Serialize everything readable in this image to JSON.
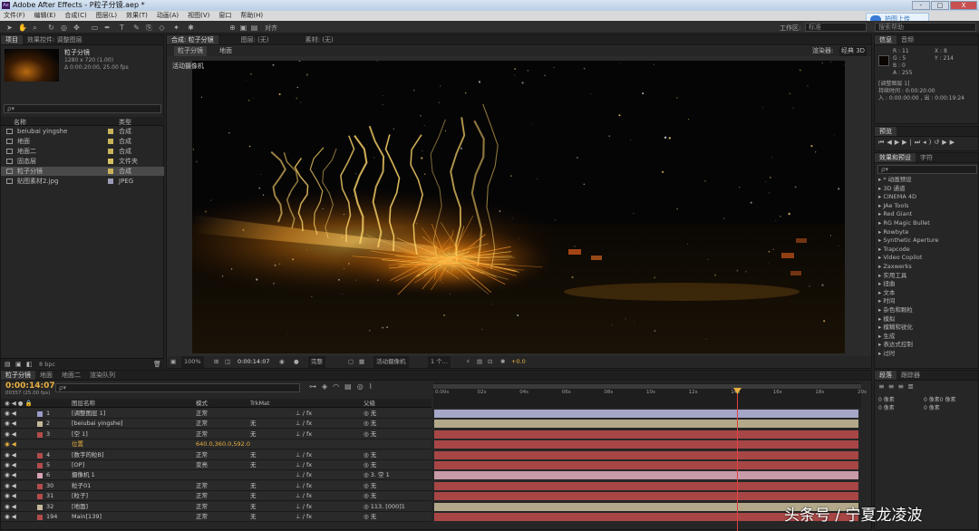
{
  "window": {
    "title": "Adobe After Effects - P粒子分镜.aep *",
    "app_icon": "Ae",
    "buttons": [
      "-",
      "□",
      "X"
    ]
  },
  "menu": [
    "文件(F)",
    "编辑(E)",
    "合成(C)",
    "图层(L)",
    "效果(T)",
    "动画(A)",
    "视图(V)",
    "窗口",
    "帮助(H)"
  ],
  "upload": {
    "label": "拍图上传"
  },
  "toolbar": {
    "snap_label": "对齐",
    "workspace_label": "工作区:",
    "workspace_value": "标准",
    "search_placeholder": "搜索帮助"
  },
  "project": {
    "tabs": [
      "项目",
      "效果控件: 调整图层"
    ],
    "item_name": "粒子分镜",
    "item_info1": "1280 x 720 (1.00)",
    "item_info2": "Δ 0:00:20:00, 25.00 fps",
    "search_placeholder": "ρ▾",
    "col_name": "名称",
    "col_type": "类型",
    "items": [
      {
        "name": "beiubai yingshe",
        "type": "合成",
        "color": "#c8b35a"
      },
      {
        "name": "地面",
        "type": "合成",
        "color": "#c8b35a"
      },
      {
        "name": "地面二",
        "type": "合成",
        "color": "#c8b35a"
      },
      {
        "name": "固态层",
        "type": "文件夹",
        "color": "#d7c060"
      },
      {
        "name": "粒子分镜",
        "type": "合成",
        "color": "#c8b35a"
      },
      {
        "name": "贴图素材2.jpg",
        "type": "JPEG",
        "color": "#9b9bb5"
      }
    ],
    "bpc": "8 bpc"
  },
  "composition": {
    "tabs": [
      "合成: 粒子分镜",
      "图层: (无)",
      "素材: (无)"
    ],
    "subtabs": [
      "粒子分镜",
      "地面"
    ],
    "renderer_label": "渲染器:",
    "renderer_value": "经典 3D",
    "camera_label": "活动摄像机",
    "footer": [
      "100%",
      "0:00:14:07",
      "完整",
      "活动摄像机",
      "1 个...",
      "+0.0"
    ]
  },
  "info": {
    "tabs": [
      "信息",
      "音频"
    ],
    "r": "R : 11",
    "g": "G : 5",
    "b": "B : 0",
    "a": "A : 255",
    "x": "X : 8",
    "y": "Y : 214",
    "layer": "[调整图层 1]",
    "duration": "持续时间 : 0:00:20:00",
    "in_out": "入 : 0:00:00:00 , 出 : 0:00:19:24"
  },
  "preview": {
    "tab": "预览"
  },
  "effects": {
    "tabs": [
      "效果和预设",
      "字符"
    ],
    "search_placeholder": "ρ▾",
    "items": [
      "* 动画预设",
      "3D 通道",
      "CINEMA 4D",
      "JAe Tools",
      "Red Giant",
      "RG Magic Bullet",
      "Rowbyte",
      "Synthetic Aperture",
      "Trapcode",
      "Video Copilot",
      "Zaxwerks",
      "实用工具",
      "扭曲",
      "文本",
      "时间",
      "杂色和颗粒",
      "模拟",
      "模糊和锐化",
      "生成",
      "表达式控制",
      "过时"
    ]
  },
  "paragraph": {
    "tabs": [
      "段落",
      "跟踪器"
    ],
    "px": [
      "0 像素",
      "0 像素",
      "0 像素",
      "0 像素",
      "0 像素"
    ]
  },
  "timeline": {
    "tabs": [
      "粒子分镜",
      "地面",
      "地面二",
      "渲染队列"
    ],
    "timecode": "0:00:14:07",
    "frames": "00357 (25.00 fps)",
    "search_placeholder": "ρ▾",
    "col_name": "图层名称",
    "col_mode": "模式",
    "col_trkmat": "TrkMat",
    "col_parent": "父级",
    "ruler": [
      "0:00s",
      "02s",
      "04s",
      "06s",
      "08s",
      "10s",
      "12s",
      "14s",
      "16s",
      "18s",
      "20s"
    ],
    "layers": [
      {
        "num": "1",
        "name": "[调整图层 1]",
        "mode": "正常",
        "trk": "",
        "parent": "无",
        "color": "#9b9bc8",
        "bar": "#a6a6c8"
      },
      {
        "num": "2",
        "name": "[beiubai yingshe]",
        "mode": "正常",
        "trk": "无",
        "parent": "无",
        "color": "#c4b79a",
        "bar": "#b3a98a"
      },
      {
        "num": "3",
        "name": "[空 1]",
        "mode": "正常",
        "trk": "无",
        "parent": "无",
        "color": "#b34b4b",
        "bar": "#a84646"
      },
      {
        "num": "",
        "name": "位置",
        "mode": "640.0,360.0,592.0",
        "trk": "",
        "parent": "",
        "color": "",
        "bar": "#a84646"
      },
      {
        "num": "4",
        "name": "[数字的粒B]",
        "mode": "正常",
        "trk": "无",
        "parent": "无",
        "color": "#b34b4b",
        "bar": "#a84646"
      },
      {
        "num": "5",
        "name": "[OP]",
        "mode": "变亮",
        "trk": "无",
        "parent": "无",
        "color": "#b34b4b",
        "bar": "#a84646"
      },
      {
        "num": "6",
        "name": "摄像机 1",
        "mode": "",
        "trk": "",
        "parent": "3. 空 1",
        "color": "#d9a3b3",
        "bar": "#c99aa8"
      },
      {
        "num": "30",
        "name": "粒子01",
        "mode": "正常",
        "trk": "无",
        "parent": "无",
        "color": "#b34b4b",
        "bar": "#a84646"
      },
      {
        "num": "31",
        "name": "[粒子]",
        "mode": "正常",
        "trk": "无",
        "parent": "无",
        "color": "#b34b4b",
        "bar": "#a84646"
      },
      {
        "num": "32",
        "name": "[地面]",
        "mode": "正常",
        "trk": "无",
        "parent": "113. [000]1",
        "color": "#c4b79a",
        "bar": "#b3a98a"
      },
      {
        "num": "194",
        "name": "Main[139]",
        "mode": "正常",
        "trk": "无",
        "parent": "无",
        "color": "#b34b4b",
        "bar": "#a84646"
      }
    ]
  },
  "watermark": "头条号 / 宁夏龙凌波",
  "colors": {
    "accent": "#e8a33a",
    "playhead": "#e04040",
    "timecode": "#e8b040"
  }
}
